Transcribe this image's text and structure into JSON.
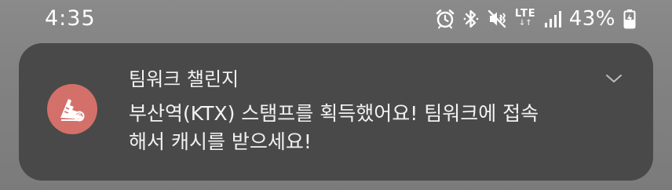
{
  "status_bar": {
    "time": "4:35",
    "network": "LTE",
    "network_arrows": "↓↑",
    "battery_percent": "43%",
    "icons": [
      "alarm-icon",
      "bluetooth-icon",
      "vibrate-icon",
      "lte-icon",
      "signal-icon",
      "battery-charging-icon"
    ]
  },
  "notification": {
    "app_name": "팀워크 챌린지",
    "message": "부산역(KTX) 스탬프를 획득했어요! 팀워크에 접속해서 캐시를 받으세요!",
    "app_icon": "teamwork-app-icon",
    "icon_color": "#d3706a",
    "card_color": "#494949"
  }
}
